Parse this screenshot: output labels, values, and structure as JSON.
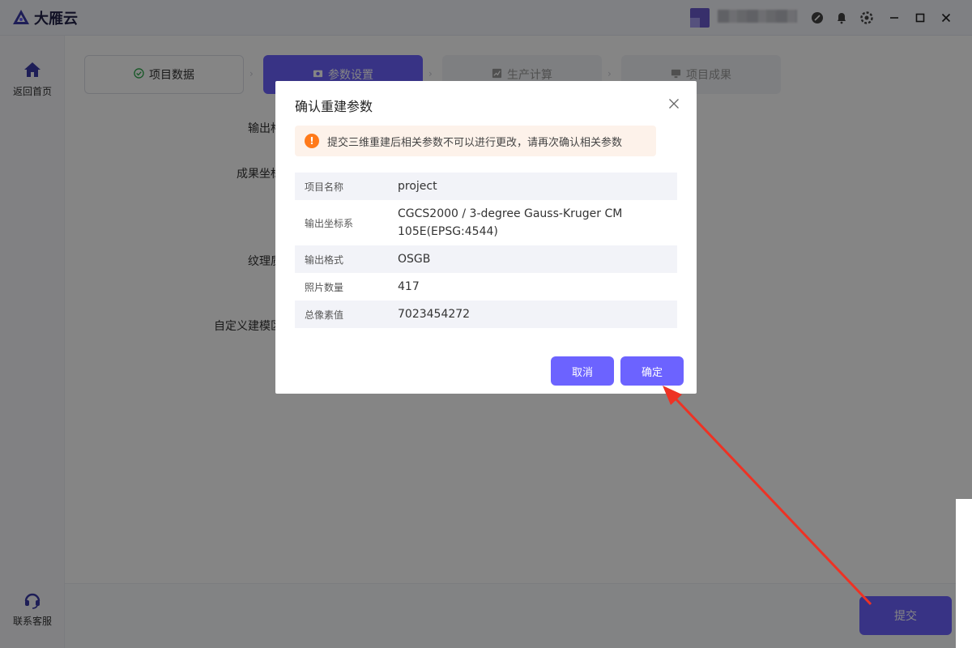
{
  "app": {
    "title": "大雁云",
    "window_controls": [
      "minimize-icon",
      "maximize-icon",
      "close-icon"
    ]
  },
  "sidebar": {
    "home_label": "返回首页",
    "support_label": "联系客服"
  },
  "steps": [
    {
      "label": "项目数据",
      "icon": "check-circle-icon",
      "state": "done"
    },
    {
      "label": "参数设置",
      "icon": "camera-icon",
      "state": "active"
    },
    {
      "label": "生产计算",
      "icon": "chart-icon",
      "state": "pending"
    },
    {
      "label": "项目成果",
      "icon": "monitor-icon",
      "state": "pending"
    }
  ],
  "form_labels": [
    "输出格",
    "成果坐标",
    "纹理质",
    "自定义建模区"
  ],
  "submit_label": "提交",
  "dialog": {
    "title": "确认重建参数",
    "warning": "提交三维重建后相关参数不可以进行更改，请再次确认相关参数",
    "rows": [
      {
        "key": "项目名称",
        "value": "project"
      },
      {
        "key": "输出坐标系",
        "value": "CGCS2000 / 3-degree Gauss-Kruger CM 105E(EPSG:4544)"
      },
      {
        "key": "输出格式",
        "value": "OSGB"
      },
      {
        "key": "照片数量",
        "value": "417"
      },
      {
        "key": "总像素值",
        "value": "7023454272"
      }
    ],
    "cancel_label": "取消",
    "ok_label": "确定"
  },
  "colors": {
    "accent": "#6c63ff",
    "warning": "#ff7a1a",
    "annotation_arrow": "#ee3224"
  }
}
